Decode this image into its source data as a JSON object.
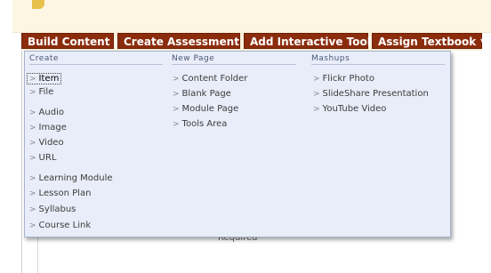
{
  "toolbar": {
    "buttons": [
      {
        "label": "Build Content"
      },
      {
        "label": "Create Assessment"
      },
      {
        "label": "Add Interactive Tool"
      },
      {
        "label": "Assign Textbook"
      }
    ]
  },
  "menu": {
    "columns": [
      {
        "header": "Create",
        "items": [
          "Item",
          "File",
          "Audio",
          "Image",
          "Video",
          "URL",
          "Learning Module",
          "Lesson Plan",
          "Syllabus",
          "Course Link"
        ]
      },
      {
        "header": "New Page",
        "items": [
          "Content Folder",
          "Blank Page",
          "Module Page",
          "Tools Area"
        ]
      },
      {
        "header": "Mashups",
        "items": [
          "Flickr Photo",
          "SlideShare Presentation",
          "YouTube Video"
        ]
      }
    ]
  },
  "page": {
    "required_text": "Required"
  },
  "colors": {
    "toolbar_button": "#8b2c0d",
    "menu_background": "#e9edf9",
    "header_band": "#fdf6e3"
  }
}
